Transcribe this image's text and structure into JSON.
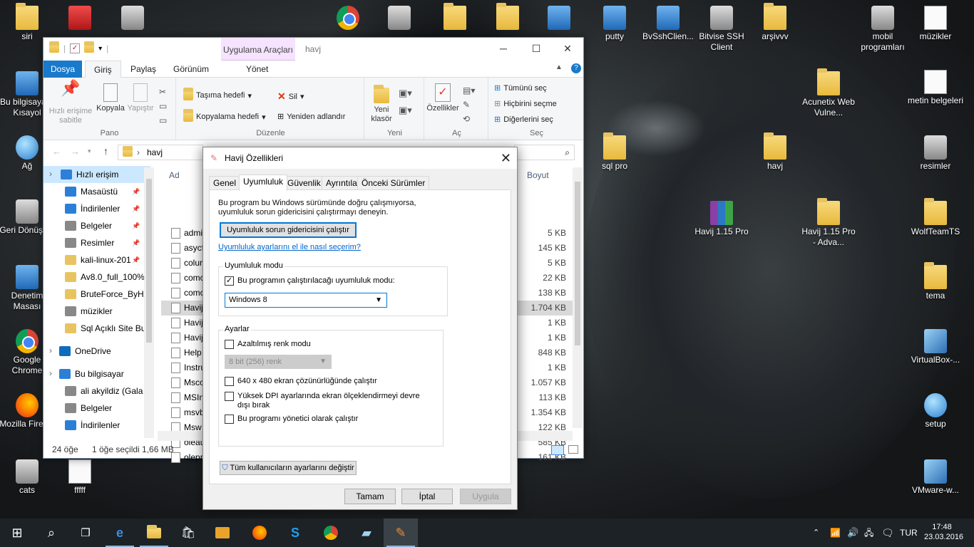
{
  "desktop": {
    "icons": [
      {
        "label": "siri",
        "kind": "fold"
      },
      {
        "label": "",
        "kind": "shield"
      },
      {
        "label": "",
        "kind": "img"
      },
      {
        "label": "",
        "kind": "chrome"
      },
      {
        "label": "",
        "kind": "figure"
      },
      {
        "label": "",
        "kind": "fold"
      },
      {
        "label": "",
        "kind": "fold"
      },
      {
        "label": "",
        "kind": "net"
      },
      {
        "label": "putty",
        "kind": "putty"
      },
      {
        "label": "BvSshClien...",
        "kind": "bv"
      },
      {
        "label": "Bitvise SSH Client",
        "kind": "bitvise"
      },
      {
        "label": "arşivvv",
        "kind": "fold"
      },
      {
        "label": "mobil programları",
        "kind": "phone"
      },
      {
        "label": "müzikler",
        "kind": "music"
      },
      {
        "label": "Bu bilgisayar - Kısayol",
        "kind": "pc"
      },
      {
        "label": "Acunetix Web Vulne...",
        "kind": "fold"
      },
      {
        "label": "metin belgeleri",
        "kind": "doc"
      },
      {
        "label": "Ağ",
        "kind": "globe"
      },
      {
        "label": "sql pro",
        "kind": "fold"
      },
      {
        "label": "havj",
        "kind": "fold"
      },
      {
        "label": "resimler",
        "kind": "camera"
      },
      {
        "label": "Geri Dönüşü...",
        "kind": "bin"
      },
      {
        "label": "Havij 1.15 Pro",
        "kind": "rar"
      },
      {
        "label": "Havij 1.15 Pro - Adva...",
        "kind": "fold"
      },
      {
        "label": "WolfTeamTS",
        "kind": "fold"
      },
      {
        "label": "Denetim Masası",
        "kind": "ctrl"
      },
      {
        "label": "tema",
        "kind": "fold"
      },
      {
        "label": "Google Chrome",
        "kind": "chrome"
      },
      {
        "label": "VirtualBox-...",
        "kind": "cube"
      },
      {
        "label": "Mozilla Firefox",
        "kind": "ff"
      },
      {
        "label": "setup",
        "kind": "disc"
      },
      {
        "label": "cats",
        "kind": "cats"
      },
      {
        "label": "fffff",
        "kind": "doc"
      },
      {
        "label": "VMware-w...",
        "kind": "vm"
      }
    ]
  },
  "explorer": {
    "context_tab": "Uygulama Araçları",
    "title": "havj",
    "tabs": [
      "Dosya",
      "Giriş",
      "Paylaş",
      "Görünüm",
      "Yönet"
    ],
    "ribbon": {
      "pin": "Hızlı erişime sabitle",
      "copy": "Kopyala",
      "paste": "Yapıştır",
      "group_pano": "Pano",
      "move_to": "Taşıma hedefi",
      "copy_to": "Kopyalama hedefi",
      "delete": "Sil",
      "rename": "Yeniden adlandır",
      "group_duzenle": "Düzenle",
      "new_folder": "Yeni klasör",
      "group_yeni": "Yeni",
      "properties": "Özellikler",
      "group_ac": "Aç",
      "select_all": "Tümünü seç",
      "select_none": "Hiçbirini seçme",
      "invert": "Diğerlerini seç",
      "group_sec": "Seç"
    },
    "address": "havj",
    "col_name": "Ad",
    "col_size": "Boyut",
    "nav": [
      {
        "label": "Hızlı erişim",
        "pin": ""
      },
      {
        "label": "Masaüstü",
        "pin": "📌"
      },
      {
        "label": "İndirilenler",
        "pin": "📌"
      },
      {
        "label": "Belgeler",
        "pin": "📌"
      },
      {
        "label": "Resimler",
        "pin": "📌"
      },
      {
        "label": "kali-linux-201",
        "pin": "📌"
      },
      {
        "label": "Av8.0_full_100%_",
        "pin": ""
      },
      {
        "label": "BruteForce_ByH4",
        "pin": ""
      },
      {
        "label": "müzikler",
        "pin": ""
      },
      {
        "label": "Sql Açıklı Site Bu",
        "pin": ""
      },
      {
        "label": "OneDrive",
        "pin": ""
      },
      {
        "label": "Bu bilgisayar",
        "pin": ""
      },
      {
        "label": "ali akyildiz (Gala",
        "pin": ""
      },
      {
        "label": "Belgeler",
        "pin": ""
      },
      {
        "label": "İndirilenler",
        "pin": ""
      }
    ],
    "files": [
      {
        "name": "admi",
        "size": "5 KB"
      },
      {
        "name": "asycf",
        "size": "145 KB"
      },
      {
        "name": "colur",
        "size": "5 KB"
      },
      {
        "name": "comc",
        "size": "22 KB"
      },
      {
        "name": "comc",
        "size": "138 KB"
      },
      {
        "name": "Havij",
        "size": "1.704 KB"
      },
      {
        "name": "Havij",
        "size": "1 KB"
      },
      {
        "name": "Havij",
        "size": "1 KB"
      },
      {
        "name": "Help",
        "size": "848 KB"
      },
      {
        "name": "Instru",
        "size": "1 KB"
      },
      {
        "name": "Mscc",
        "size": "1.057 KB"
      },
      {
        "name": "MSIn",
        "size": "113 KB"
      },
      {
        "name": "msvb",
        "size": "1.354 KB"
      },
      {
        "name": "Msw",
        "size": "122 KB"
      },
      {
        "name": "oleau",
        "size": "585 KB"
      },
      {
        "name": "olepr",
        "size": "161 KB"
      }
    ],
    "status_count": "24 öğe",
    "status_selected": "1 öğe seçildi  1,66 MB"
  },
  "dialog": {
    "title": "Havij Özellikleri",
    "tabs": [
      "Genel",
      "Uyumluluk",
      "Güvenlik",
      "Ayrıntılar",
      "Önceki Sürümler"
    ],
    "intro": "Bu program bu Windows sürümünde doğru çalışmıyorsa, uyumluluk sorun gidericisini çalıştırmayı deneyin.",
    "run_troubleshooter": "Uyumluluk sorun gidericisini çalıştır",
    "manual_link": "Uyumluluk ayarlarını el ile nasıl seçerim?",
    "compat_group": "Uyumluluk modu",
    "compat_check": "Bu programın çalıştırılacağı uyumluluk modu:",
    "compat_value": "Windows 8",
    "settings_group": "Ayarlar",
    "reduced_color": "Azaltılmış renk modu",
    "color_value": "8 bit (256) renk",
    "res640": "640 x 480 ekran çözünürlüğünde çalıştır",
    "dpi": "Yüksek DPI ayarlarında ekran ölçeklendirmeyi devre dışı bırak",
    "admin": "Bu programı yönetici olarak çalıştır",
    "all_users": "Tüm kullanıcıların ayarlarını değiştir",
    "ok": "Tamam",
    "cancel": "İptal",
    "apply": "Uygula"
  },
  "taskbar": {
    "lang": "TUR",
    "time": "17:48",
    "date": "23.03.2016"
  }
}
